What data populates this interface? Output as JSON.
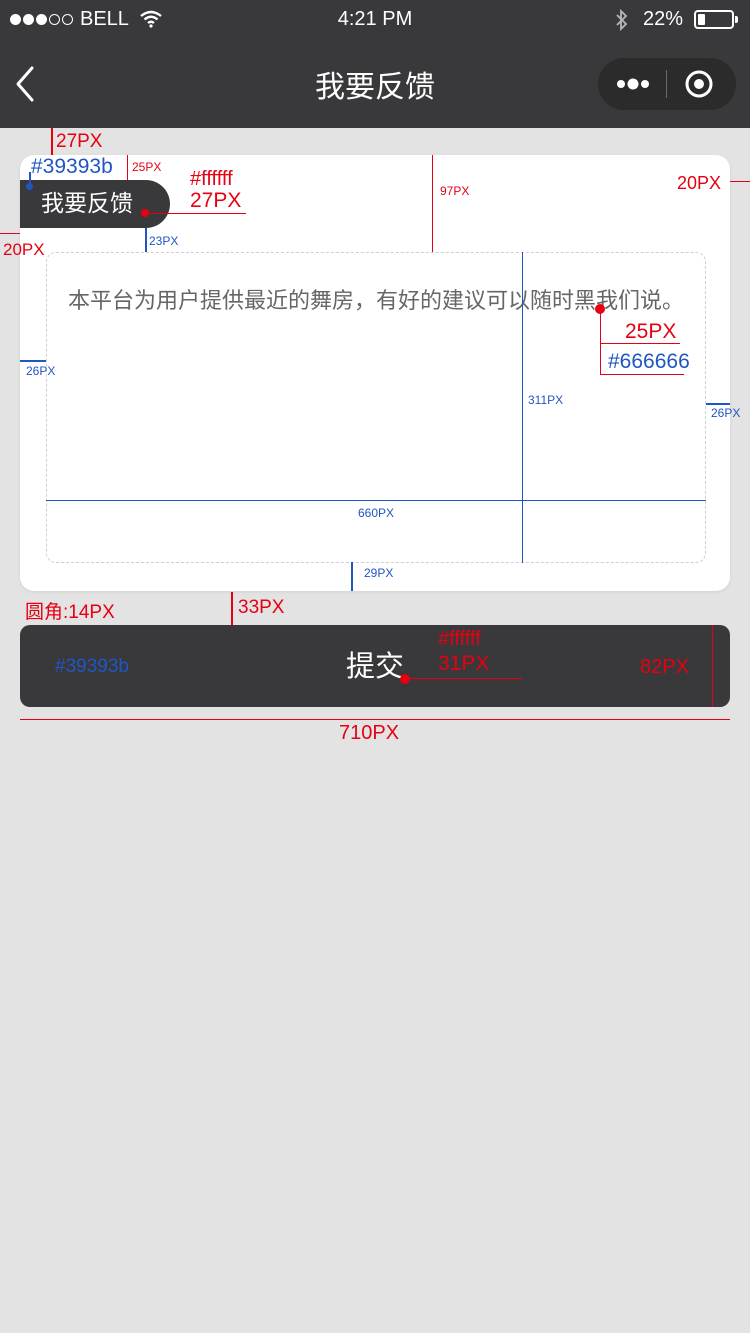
{
  "status_bar": {
    "carrier": "BELL",
    "time": "4:21 PM",
    "battery": "22%",
    "battery_level": 0.22,
    "signal_bars": 3,
    "signal_total": 5
  },
  "nav": {
    "title": "我要反馈",
    "icons": {
      "back": "chevron-left-icon",
      "more": "more-dots-icon",
      "close": "target-close-icon"
    }
  },
  "card": {
    "tag_label": "我要反馈",
    "textarea_text": "本平台为用户提供最近的舞房，有好的建议可以随时黑我们说。"
  },
  "submit": {
    "label": "提交"
  },
  "colors": {
    "nav_bg": "#39393b",
    "page_bg": "#e3e3e3",
    "card_bg": "#ffffff",
    "text_gray": "#666666",
    "annotation_red": "#e60012",
    "annotation_blue": "#1f56c4"
  },
  "annotations": {
    "a27px_top": "27PX",
    "color_39393b_1": "#39393b",
    "a25px_small": "25PX",
    "color_ffffff_1": "#ffffff",
    "a27px_font": "27PX",
    "a97px": "97PX",
    "a20px_right": "20PX",
    "a20px_left": "20PX",
    "a23px": "23PX",
    "a25px_font": "25PX",
    "color_666666": "#666666",
    "a26px_left": "26PX",
    "a26px_right": "26PX",
    "a311px": "311PX",
    "a660px": "660PX",
    "a29px": "29PX",
    "radius_14px": "圆角:14PX",
    "a33px": "33PX",
    "color_39393b_2": "#39393b",
    "color_ffffff_2": "#ffffff",
    "a31px": "31PX",
    "a82px": "82PX",
    "a710px": "710PX"
  }
}
